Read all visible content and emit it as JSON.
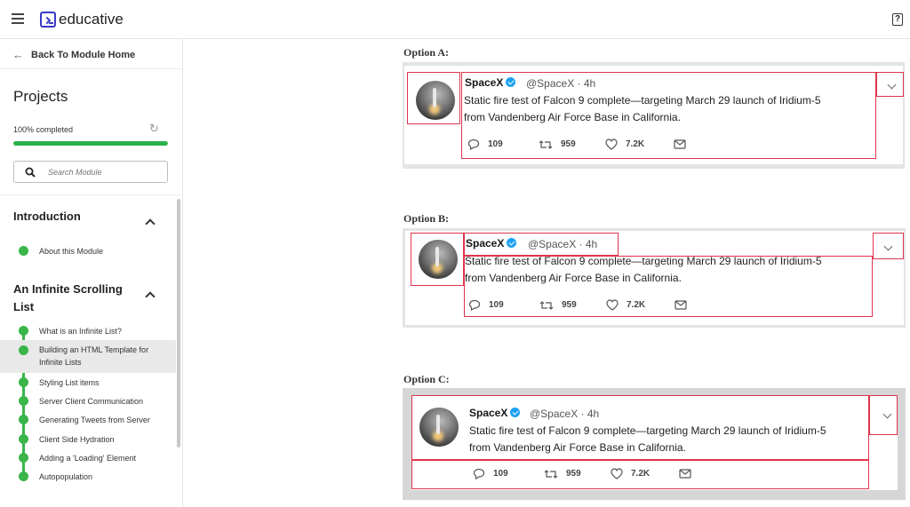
{
  "app": {
    "logo_text": "educative",
    "help_label": "?"
  },
  "sidebar": {
    "back_label": "Back To Module Home",
    "title": "Projects",
    "progress_label": "100% completed",
    "progress": 1.0,
    "search_placeholder": "Search Module",
    "sections": [
      {
        "title": "Introduction",
        "lessons": [
          {
            "label": "About this Module"
          }
        ]
      },
      {
        "title": "An Infinite Scrolling List",
        "lessons": [
          {
            "label": "What is an Infinite List?"
          },
          {
            "label": "Building an HTML Template for Infinite Lists",
            "active": true
          },
          {
            "label": "Styling List items"
          },
          {
            "label": "Server Client Communication"
          },
          {
            "label": "Generating Tweets from Server"
          },
          {
            "label": "Client Side Hydration"
          },
          {
            "label": "Adding a 'Loading' Element"
          },
          {
            "label": "Autopopulation"
          }
        ]
      }
    ]
  },
  "options": [
    {
      "label": "Option A:"
    },
    {
      "label": "Option B:"
    },
    {
      "label": "Option C:"
    }
  ],
  "tweet": {
    "name": "SpaceX",
    "handle": "@SpaceX · 4h",
    "line1": "Static fire test of Falcon 9 complete—targeting March 29 launch of Iridium-5",
    "line2": "from Vandenberg Air Force Base in California.",
    "replies": "109",
    "retweets": "959",
    "likes": "7.2K"
  },
  "colors": {
    "accent": "#28b14a",
    "highlight": "#e0344d",
    "verified": "#1da1f2",
    "logo": "#3a3ac8"
  },
  "icons": [
    "menu-icon",
    "help-icon",
    "arrow-left-icon",
    "refresh-icon",
    "search-icon",
    "chevron-up-icon",
    "reply-icon",
    "retweet-icon",
    "heart-icon",
    "mail-icon",
    "chevron-down-icon",
    "verified-icon"
  ]
}
